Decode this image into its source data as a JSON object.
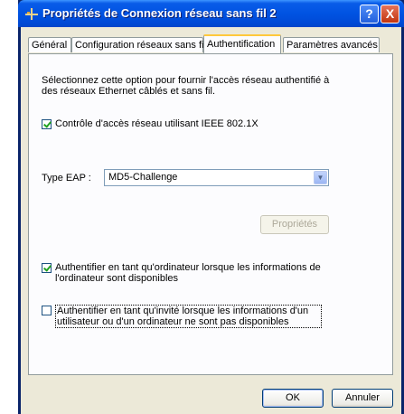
{
  "window": {
    "title": "Propriétés de Connexion réseau sans fil 2",
    "help_label": "?",
    "close_label": "X"
  },
  "tabs": [
    {
      "label": "Général",
      "active": false
    },
    {
      "label": "Configuration réseaux sans fil",
      "active": false
    },
    {
      "label": "Authentification",
      "active": true
    },
    {
      "label": "Paramètres avancés",
      "active": false
    }
  ],
  "panel": {
    "description": "Sélectionnez cette option pour fournir l'accès réseau authentifié à des réseaux Ethernet câblés et sans fil.",
    "ieee_checkbox": {
      "label": "Contrôle d'accès réseau utilisant IEEE 802.1X",
      "checked": true
    },
    "eap_label": "Type EAP :",
    "eap_value": "MD5-Challenge",
    "properties_button": "Propriétés",
    "computer_auth": {
      "label": "Authentifier en tant qu'ordinateur lorsque les informations de l'ordinateur sont disponibles",
      "checked": true
    },
    "guest_auth": {
      "label": "Authentifier en tant qu'invité lorsque les informations d'un utilisateur ou d'un ordinateur ne sont pas disponibles",
      "checked": false
    }
  },
  "buttons": {
    "ok": "OK",
    "cancel": "Annuler"
  }
}
